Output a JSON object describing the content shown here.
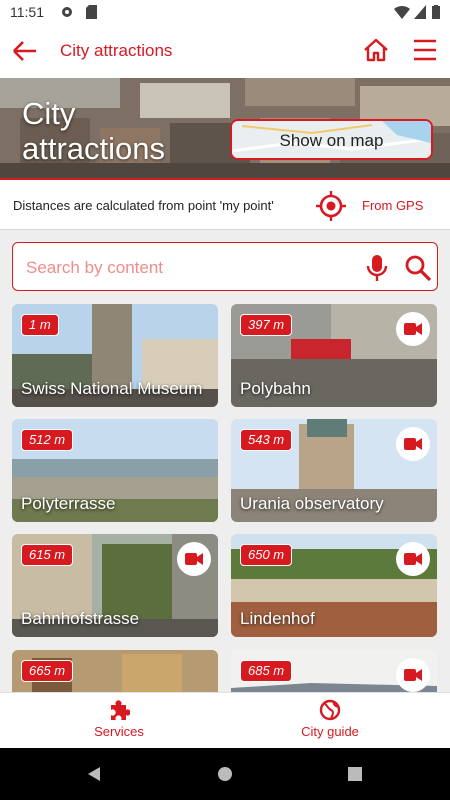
{
  "status_bar": {
    "time": "11:51",
    "icons": [
      "gear-icon",
      "sd-card-icon",
      "wifi-icon",
      "signal-icon",
      "battery-icon"
    ]
  },
  "app_bar": {
    "title": "City attractions",
    "icons": [
      "back-arrow-icon",
      "home-icon",
      "menu-icon"
    ]
  },
  "hero": {
    "title": "City attractions",
    "map_button_label": "Show on map"
  },
  "distance_info": {
    "text": "Distances are calculated from point 'my point'",
    "gps_label": "From GPS",
    "icon": "target-icon"
  },
  "search": {
    "placeholder": "Search by content",
    "icons": [
      "microphone-icon",
      "search-icon"
    ]
  },
  "attractions": [
    {
      "name": "Swiss National Museum",
      "distance": "1 m",
      "video": false
    },
    {
      "name": "Polybahn",
      "distance": "397 m",
      "video": true
    },
    {
      "name": "Polyterrasse",
      "distance": "512 m",
      "video": false
    },
    {
      "name": "Urania observatory",
      "distance": "543 m",
      "video": true
    },
    {
      "name": "Bahnhofstrasse",
      "distance": "615 m",
      "video": true
    },
    {
      "name": "Lindenhof",
      "distance": "650 m",
      "video": true
    },
    {
      "name": "",
      "distance": "665 m",
      "video": false
    },
    {
      "name": "",
      "distance": "685 m",
      "video": true
    }
  ],
  "bottom_nav": [
    {
      "label": "Services",
      "icon": "puzzle-icon"
    },
    {
      "label": "City guide",
      "icon": "globe-icon"
    }
  ],
  "colors": {
    "accent": "#d71920",
    "background": "#eeeeee"
  }
}
